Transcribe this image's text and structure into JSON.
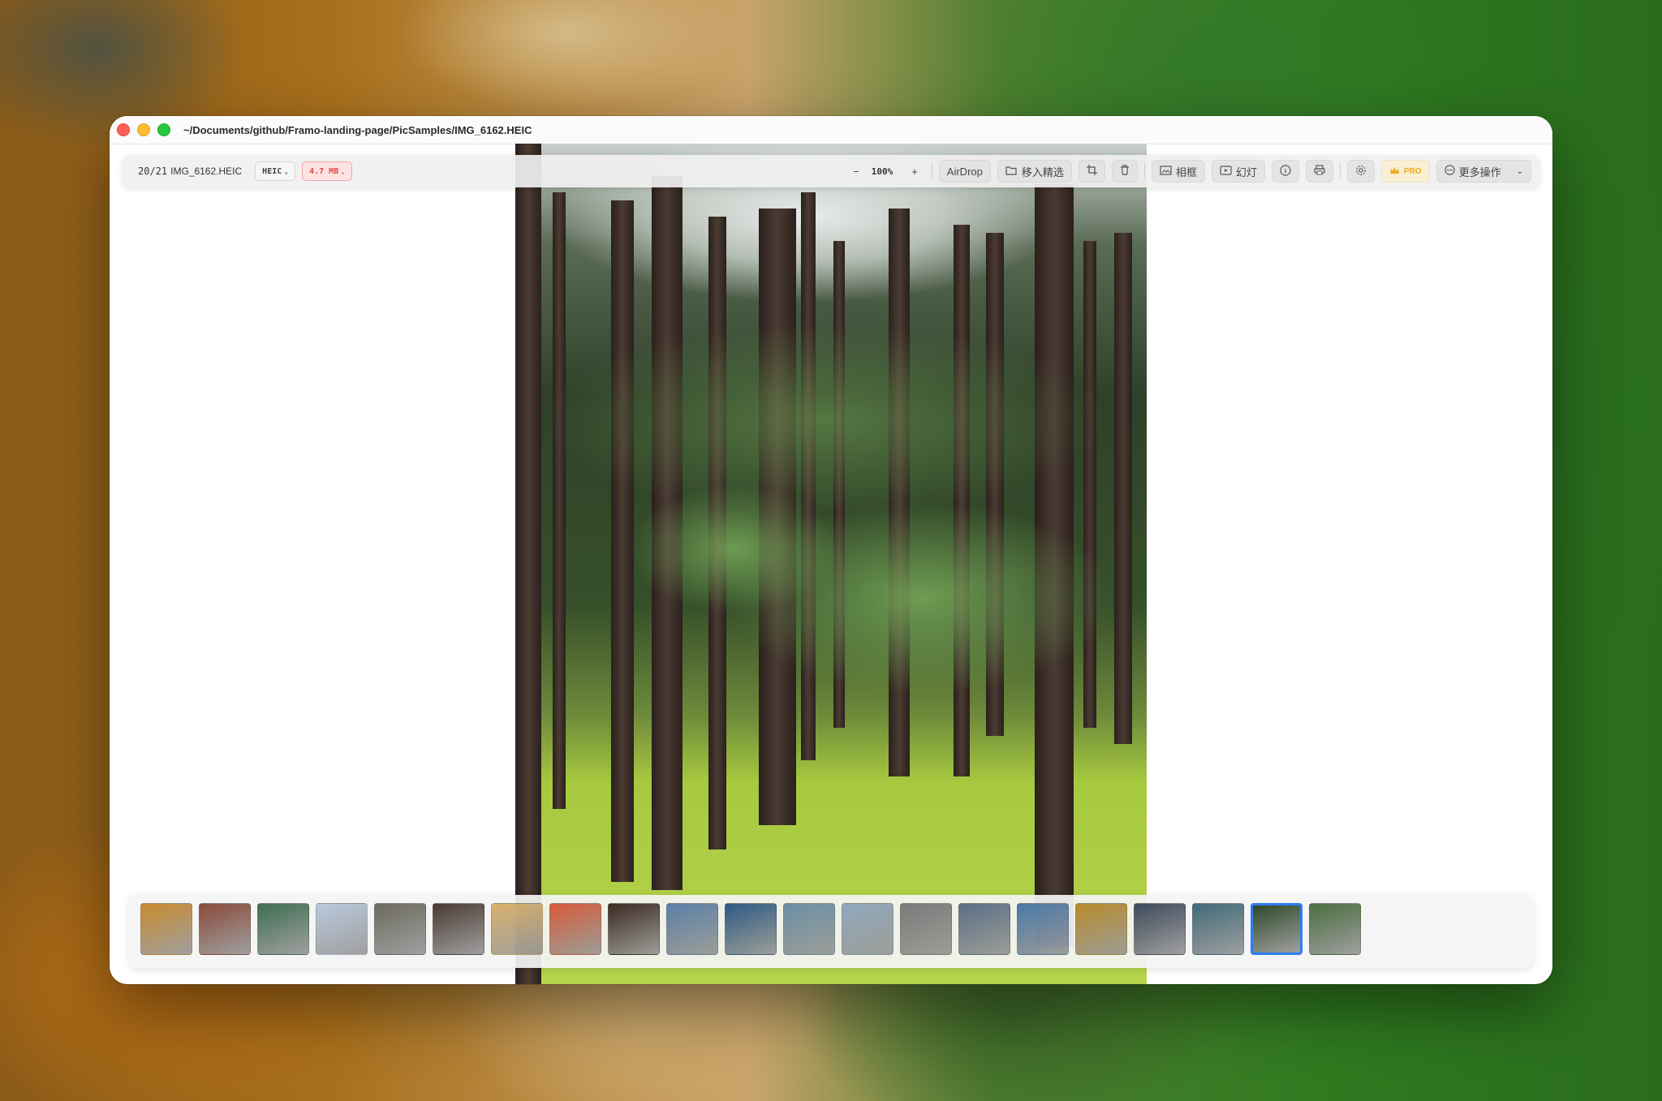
{
  "window": {
    "title": "~/Documents/github/Framo-landing-page/PicSamples/IMG_6162.HEIC"
  },
  "toolbar": {
    "counter": "20/21",
    "file_name": "IMG_6162.HEIC",
    "format_label": "HEIC",
    "size_label": "4.7 MB",
    "zoom_value": "100%",
    "airdrop_label": "AirDrop",
    "move_label": "移入精选",
    "frame_label": "相框",
    "slideshow_label": "幻灯",
    "pro_label": "PRO",
    "more_label": "更多操作",
    "icons": [
      "chevron-down-icon",
      "zoom-out-icon",
      "zoom-in-icon",
      "folder-move-icon",
      "crop-icon",
      "trash-icon",
      "photo-frame-icon",
      "slideshow-icon",
      "info-icon",
      "printer-icon",
      "gear-icon",
      "crown-icon",
      "more-icon"
    ]
  },
  "filmstrip": {
    "count": 21,
    "active_index": 19,
    "thumbnails": [
      {
        "subject": "autumn-tree",
        "color": "#c98a2e"
      },
      {
        "subject": "street-buildings",
        "color": "#8a4a3a"
      },
      {
        "subject": "strawberry-treat",
        "color": "#3f6e52"
      },
      {
        "subject": "cherry-blossom",
        "color": "#b9c8dc"
      },
      {
        "subject": "shop-interior",
        "color": "#6c6a5e"
      },
      {
        "subject": "bakery-shelf",
        "color": "#4a3b32"
      },
      {
        "subject": "bread-loaves",
        "color": "#d8b06a"
      },
      {
        "subject": "bottled-drinks",
        "color": "#d65a3a"
      },
      {
        "subject": "cafe-scene",
        "color": "#3c2a22"
      },
      {
        "subject": "harbor-view",
        "color": "#5a7fa8"
      },
      {
        "subject": "sea-rocks",
        "color": "#2d5a84"
      },
      {
        "subject": "coastline",
        "color": "#6a8fa6"
      },
      {
        "subject": "pier",
        "color": "#8fa8bd"
      },
      {
        "subject": "street-cars",
        "color": "#7a7a7a"
      },
      {
        "subject": "city-street",
        "color": "#5b6e86"
      },
      {
        "subject": "blue-jeep",
        "color": "#4a78a8"
      },
      {
        "subject": "fruit-stall",
        "color": "#b88a2a"
      },
      {
        "subject": "storefront",
        "color": "#3e4a5c"
      },
      {
        "subject": "bay-overlook",
        "color": "#3f6a78"
      },
      {
        "subject": "green-forest",
        "color": "#2f4a28"
      },
      {
        "subject": "forest-fern",
        "color": "#4a6e3e"
      }
    ]
  },
  "colors": {
    "accent": "#2f7df6",
    "size_badge": "#e0474c",
    "pro": "#f0a91f",
    "close": "#ff5f57",
    "minimize": "#febc2e",
    "zoom": "#28c840"
  }
}
